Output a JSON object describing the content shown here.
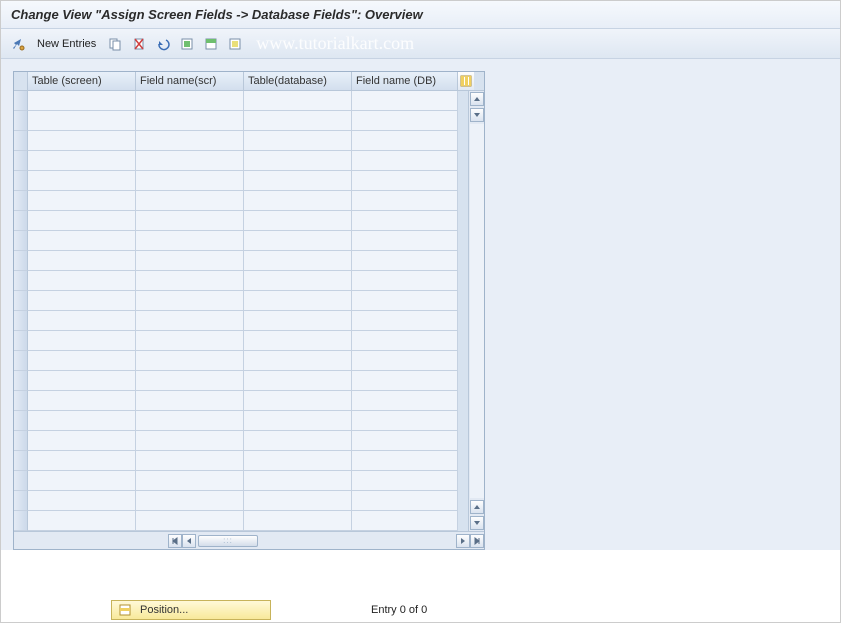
{
  "header": {
    "title": "Change View \"Assign Screen Fields -> Database Fields\": Overview"
  },
  "toolbar": {
    "new_entries_label": "New Entries"
  },
  "watermark": "www.tutorialkart.com",
  "grid": {
    "columns": [
      "Table (screen)",
      "Field name(scr)",
      "Table(database)",
      "Field name (DB)"
    ],
    "row_count": 22,
    "rows": []
  },
  "footer": {
    "position_label": "Position...",
    "entry_text": "Entry 0 of 0"
  }
}
